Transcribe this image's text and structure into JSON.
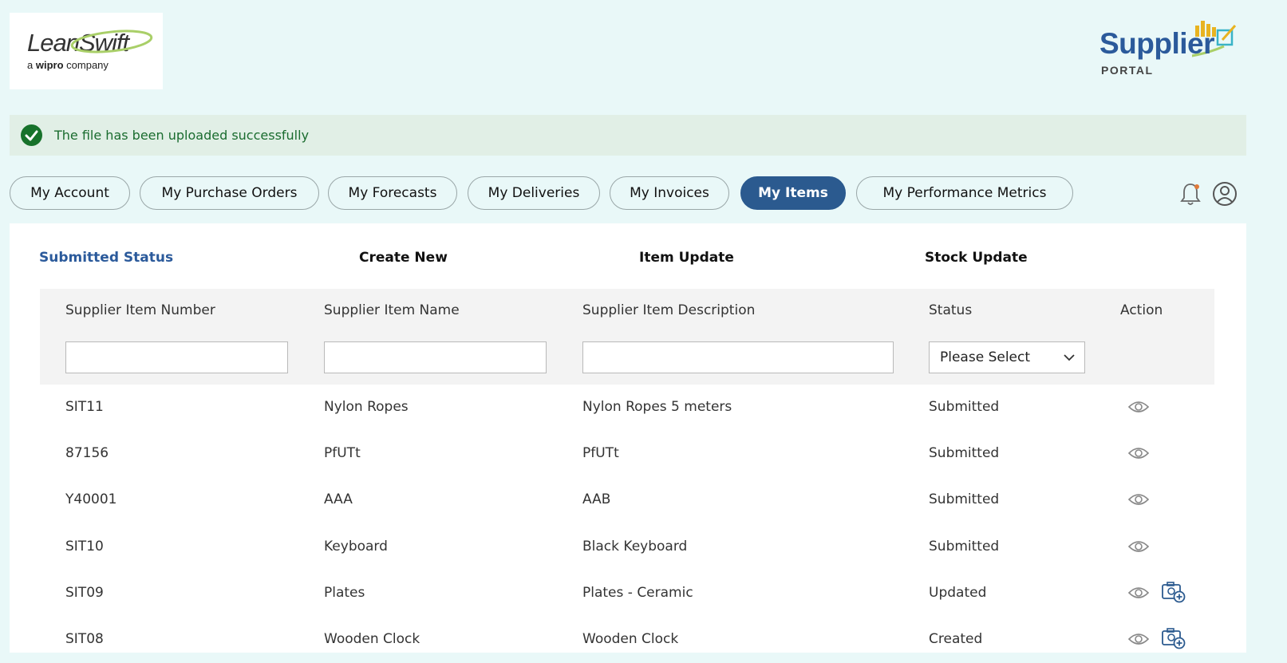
{
  "brand": {
    "logo_main": "LeanSwift",
    "logo_sub_prefix": "a",
    "logo_sub_bold": "wipro",
    "logo_sub_suffix": "company",
    "portal_title": "Supplier",
    "portal_sub": "PORTAL"
  },
  "alert": {
    "message": "The file has been uploaded successfully",
    "icon": "check-circle-icon",
    "color": "#17722b"
  },
  "tabs": [
    {
      "label": "My Account",
      "active": false
    },
    {
      "label": "My Purchase Orders",
      "active": false
    },
    {
      "label": "My Forecasts",
      "active": false
    },
    {
      "label": "My Deliveries",
      "active": false
    },
    {
      "label": "My Invoices",
      "active": false
    },
    {
      "label": "My Items",
      "active": true
    },
    {
      "label": "My Performance Metrics",
      "active": false
    }
  ],
  "header_icons": [
    "bell-icon",
    "user-icon"
  ],
  "subnav": [
    {
      "label": "Submitted Status",
      "selected": true
    },
    {
      "label": "Create New",
      "selected": false
    },
    {
      "label": "Item Update",
      "selected": false
    },
    {
      "label": "Stock Update",
      "selected": false
    }
  ],
  "table": {
    "columns": [
      "Supplier Item Number",
      "Supplier Item Name",
      "Supplier Item Description",
      "Status",
      "Action"
    ],
    "filters": {
      "item_number": "",
      "item_name": "",
      "item_description": "",
      "status_selected": "Please Select"
    },
    "rows": [
      {
        "number": "SIT11",
        "name": "Nylon Ropes",
        "description": "Nylon Ropes 5 meters",
        "status": "Submitted",
        "actions": [
          "view-icon"
        ]
      },
      {
        "number": "87156",
        "name": "PfUTt",
        "description": "PfUTt",
        "status": "Submitted",
        "actions": [
          "view-icon"
        ]
      },
      {
        "number": "Y40001",
        "name": "AAA",
        "description": "AAB",
        "status": "Submitted",
        "actions": [
          "view-icon"
        ]
      },
      {
        "number": "SIT10",
        "name": "Keyboard",
        "description": "Black Keyboard",
        "status": "Submitted",
        "actions": [
          "view-icon"
        ]
      },
      {
        "number": "SIT09",
        "name": "Plates",
        "description": "Plates - Ceramic",
        "status": "Updated",
        "actions": [
          "view-icon",
          "add-image-icon"
        ]
      },
      {
        "number": "SIT08",
        "name": "Wooden Clock",
        "description": "Wooden Clock",
        "status": "Created",
        "actions": [
          "view-icon",
          "add-image-icon"
        ]
      }
    ]
  },
  "colors": {
    "page_bg": "#e9f8f8",
    "accent": "#2b5a8f",
    "alert_bg": "#e1efe6",
    "alert_text": "#1a6c2f"
  }
}
